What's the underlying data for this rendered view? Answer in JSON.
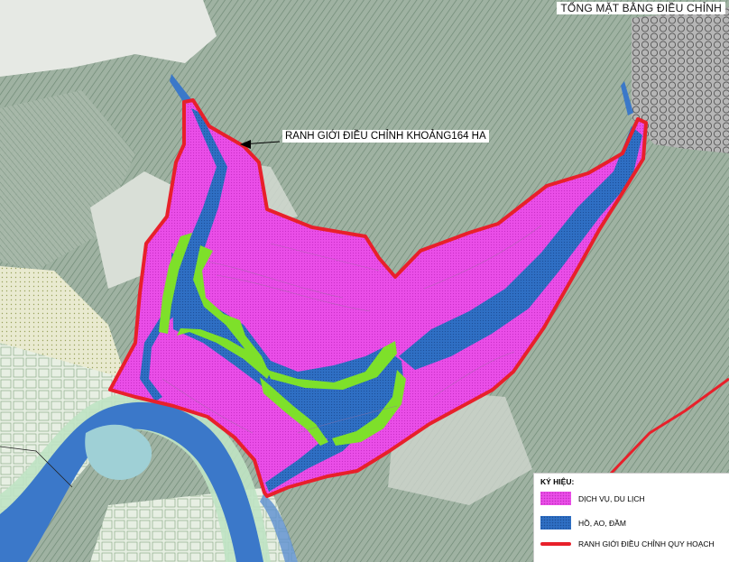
{
  "map": {
    "title": "TỔNG MẶT BẰNG ĐIỀU CHỈNH",
    "boundary_label": "RANH GIỚI ĐIỀU CHỈNH KHOẢNG164 HA"
  },
  "legend": {
    "title": "KÝ HIỆU:",
    "items": [
      {
        "label": "DỊCH VỤ, DU LỊCH",
        "color": "#ea4ee8"
      },
      {
        "label": "HỒ, AO, ĐẦM",
        "color": "#2f6fc4"
      },
      {
        "label": "RANH GIỚI ĐIỀU CHỈNH QUY HOẠCH",
        "color": "#e8202a"
      }
    ]
  },
  "colors": {
    "terrain": "#8fa593",
    "terrain_light": "#c9d6c8",
    "service_zone": "#ea4ee8",
    "water": "#2f6fc4",
    "green_belt": "#7ee02a",
    "boundary": "#e8202a",
    "river_band": "#bfe3c3"
  }
}
